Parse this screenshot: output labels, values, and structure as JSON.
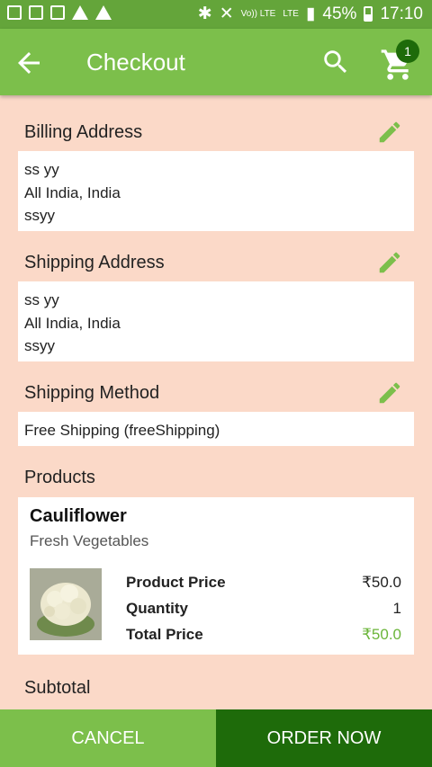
{
  "status_bar": {
    "battery": "45%",
    "time": "17:10",
    "network_volte": "Vo)) LTE",
    "network_lte": "LTE"
  },
  "app_bar": {
    "title": "Checkout",
    "cart_count": "1"
  },
  "billing": {
    "title": "Billing Address",
    "lines": [
      "ss yy",
      "All India, India",
      "ssyy"
    ]
  },
  "shipping": {
    "title": "Shipping Address",
    "lines": [
      "ss yy",
      "All India, India",
      "ssyy"
    ]
  },
  "shipping_method": {
    "title": "Shipping Method",
    "value": "Free Shipping (freeShipping)"
  },
  "products": {
    "title": "Products",
    "items": [
      {
        "name": "Cauliflower",
        "category": "Fresh Vegetables",
        "price_label": "Product Price",
        "price": "₹50.0",
        "qty_label": "Quantity",
        "qty": "1",
        "total_label": "Total Price",
        "total": "₹50.0"
      }
    ]
  },
  "subtotal": {
    "title": "Subtotal"
  },
  "actions": {
    "cancel": "CANCEL",
    "order": "ORDER NOW"
  },
  "colors": {
    "app_bar": "#7cbf4b",
    "status_bar": "#64a53a",
    "background": "#fbd9c8",
    "dark_green": "#1e6b0a",
    "price_green": "#6bb53a"
  }
}
